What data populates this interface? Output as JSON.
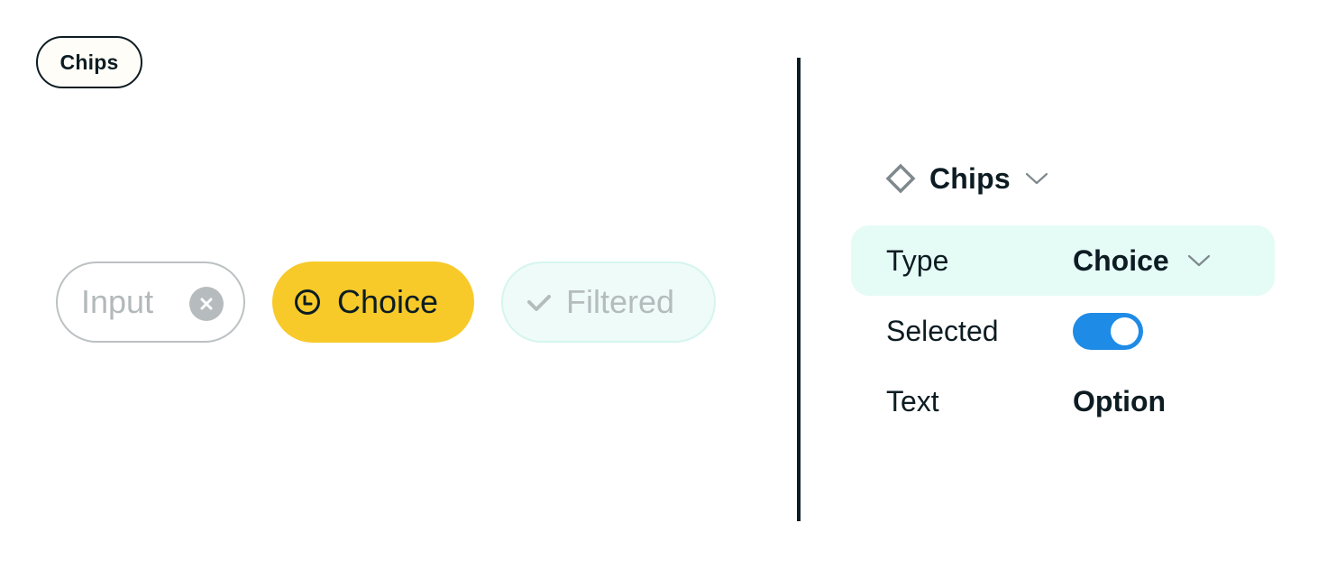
{
  "title_pill": {
    "label": "Chips"
  },
  "preview": {
    "chips": [
      {
        "type": "input",
        "label": "Input",
        "icon": "close-circle-icon",
        "state": "disabled"
      },
      {
        "type": "choice",
        "label": "Choice",
        "icon": "clock-icon",
        "state": "selected",
        "color": "#f7ca2a"
      },
      {
        "type": "filtered",
        "label": "Filtered",
        "icon": "check-icon",
        "state": "disabled"
      }
    ]
  },
  "panel": {
    "header": {
      "icon": "diamond-icon",
      "title": "Chips",
      "dropdown_icon": "chevron-down-icon"
    },
    "properties": [
      {
        "label": "Type",
        "value": "Choice",
        "control": "dropdown"
      },
      {
        "label": "Selected",
        "value": true,
        "control": "toggle"
      },
      {
        "label": "Text",
        "value": "Option",
        "control": "text"
      }
    ]
  },
  "colors": {
    "text_dark": "#0c1c22",
    "accent_yellow": "#f7ca2a",
    "toggle_blue": "#1e8be6",
    "highlight_mint": "#e5fbf6",
    "disabled_gray": "#b5bcbe"
  }
}
